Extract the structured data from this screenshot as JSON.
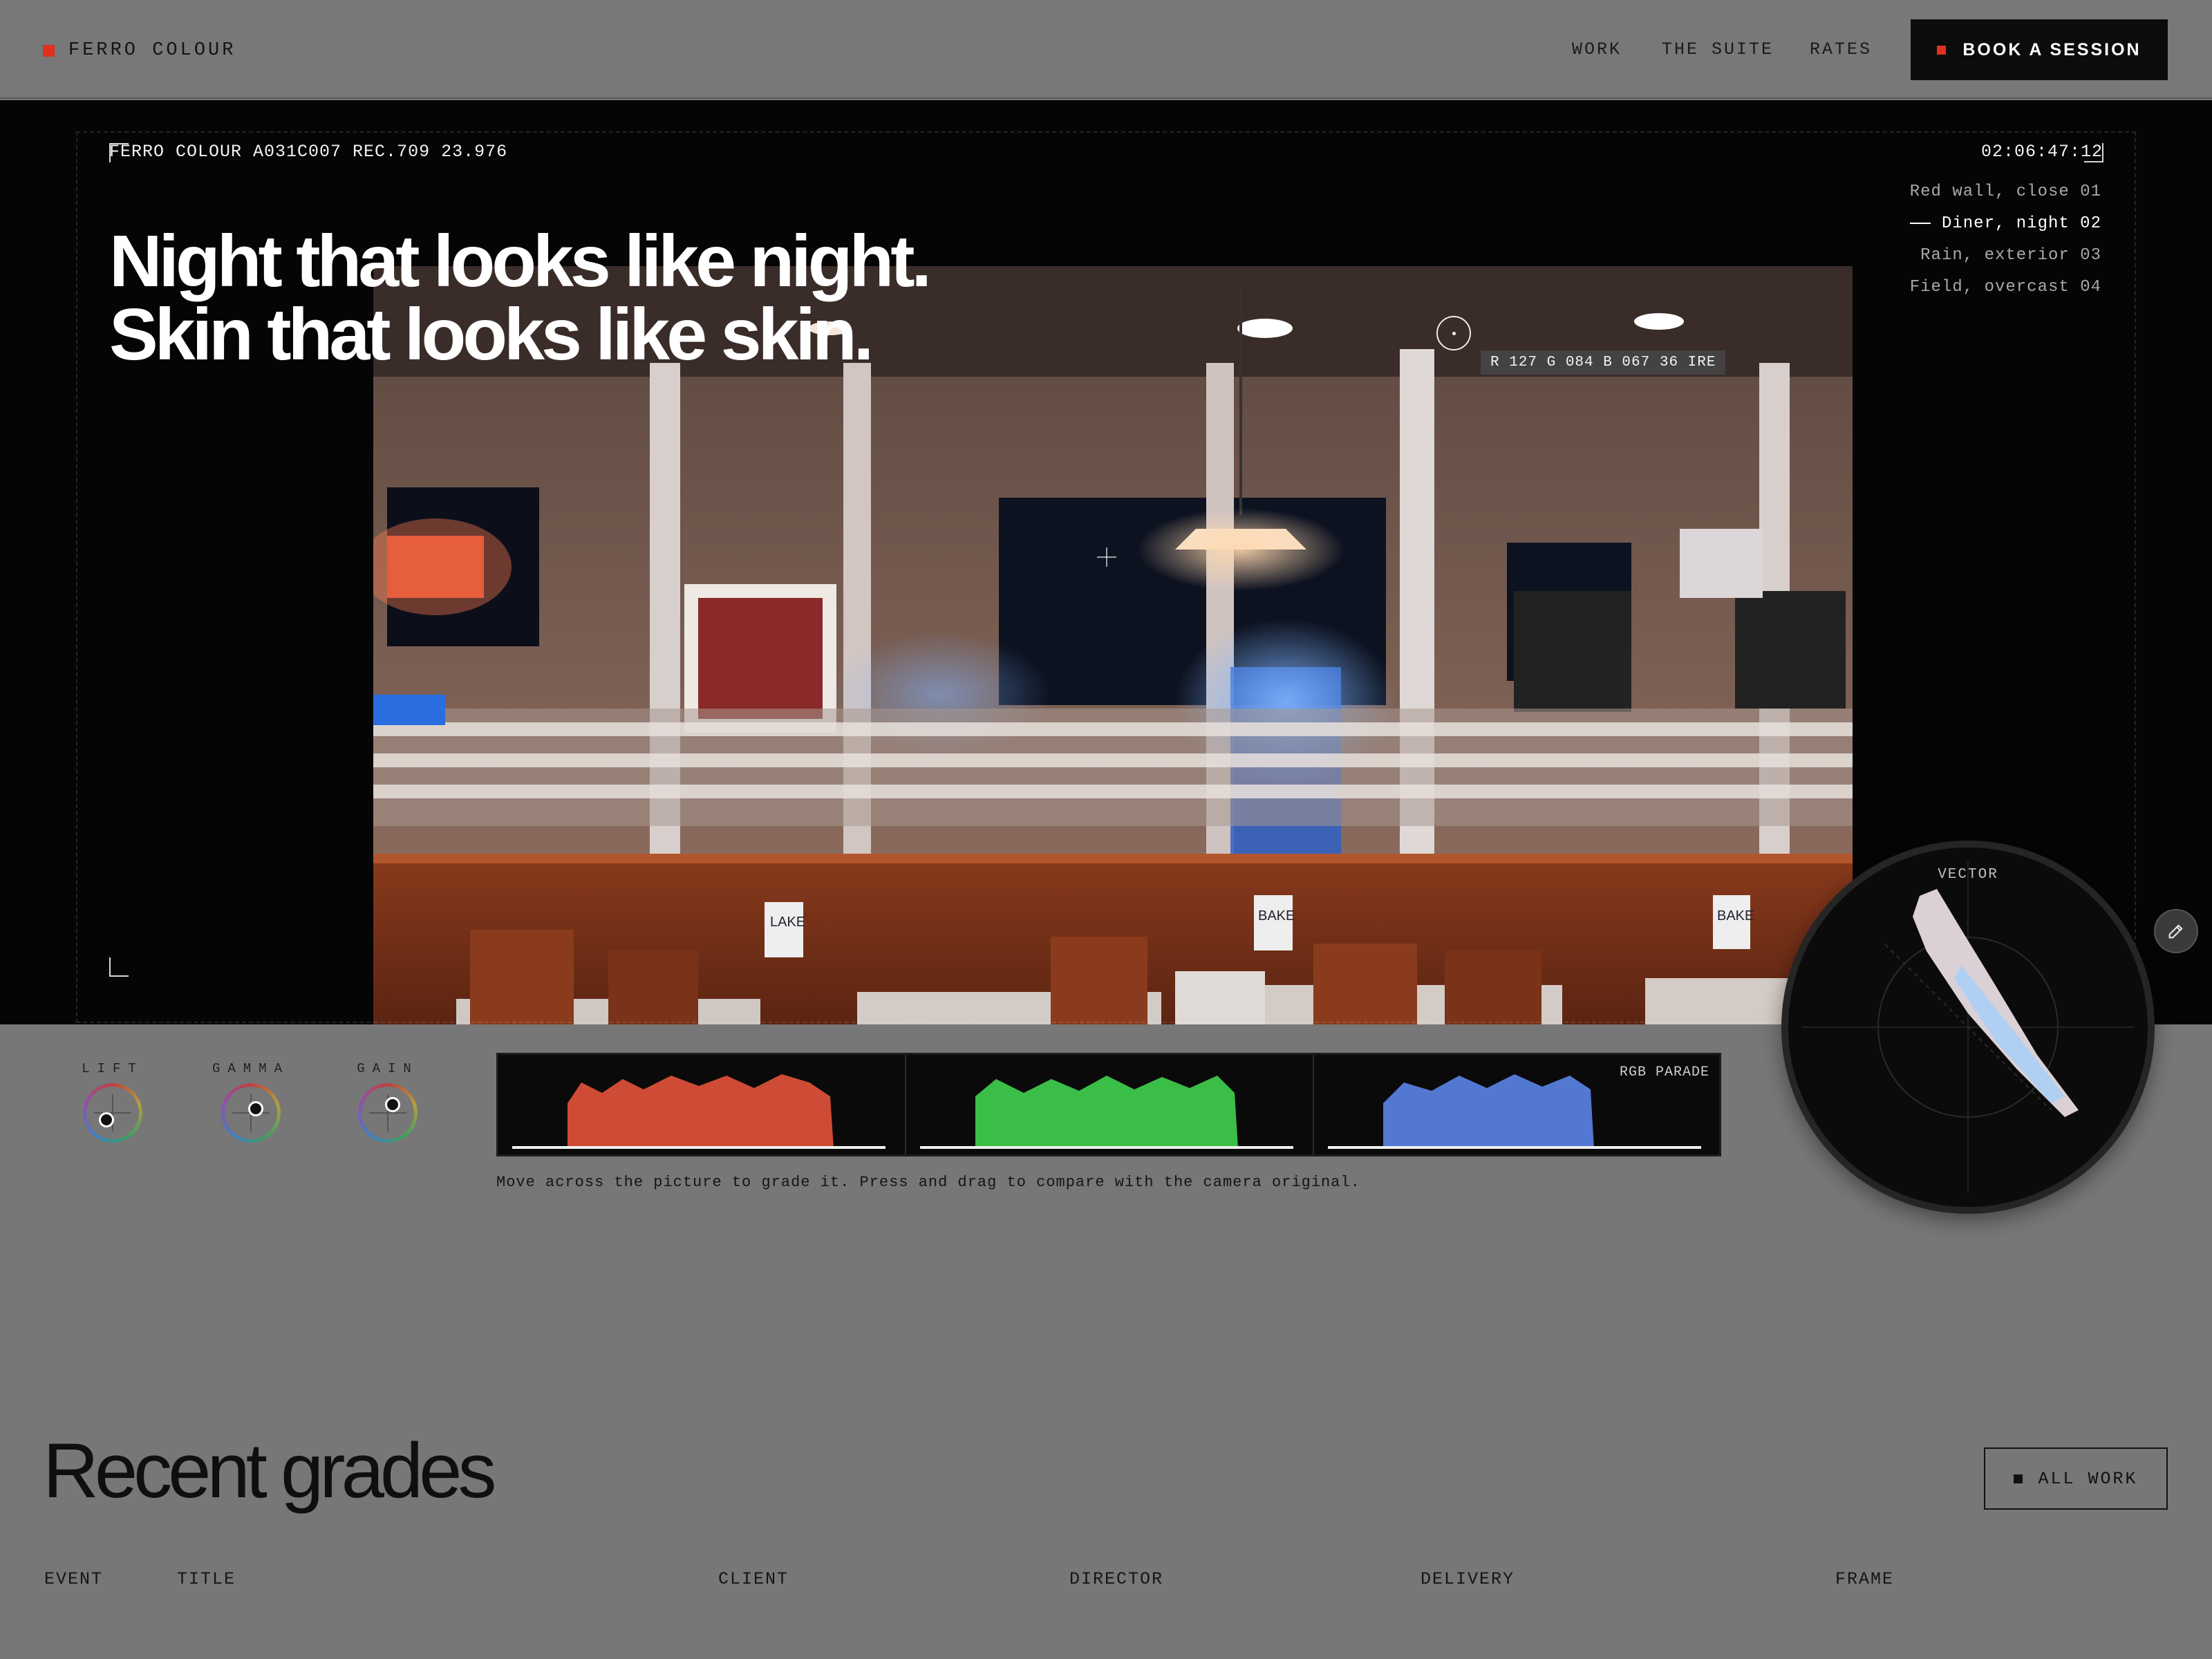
{
  "brand": {
    "name": "FERRO COLOUR",
    "accent_color": "#e0301e"
  },
  "nav": {
    "links": [
      "WORK",
      "THE SUITE",
      "RATES"
    ],
    "cta": "BOOK A SESSION"
  },
  "hero": {
    "clip_meta": "FERRO COLOUR A031C007 REC.709 23.976",
    "timecode": "02:06:47:12",
    "shots": [
      {
        "label": "Red wall, close 01",
        "active": false
      },
      {
        "label": "Diner, night 02",
        "active": true
      },
      {
        "label": "Rain, exterior 03",
        "active": false
      },
      {
        "label": "Field, overcast 04",
        "active": false
      }
    ],
    "headline_line1": "Night that looks like night.",
    "headline_line2": "Skin that looks like skin.",
    "pixel_readout": "R 127 G 084 B 067 36 IRE",
    "edit_icon": "pencil-icon",
    "photo_signs": [
      "LAKE",
      "BAKE",
      "BAKE"
    ]
  },
  "grading": {
    "wheels": [
      {
        "label": "LIFT"
      },
      {
        "label": "GAMMA"
      },
      {
        "label": "GAIN"
      }
    ],
    "parade_label": "RGB PARADE",
    "vectorscope_label": "VECTOR",
    "hint": "Move across the picture to grade it. Press and drag to compare with the camera original."
  },
  "recent": {
    "title": "Recent grades",
    "all_work": "ALL WORK",
    "columns": [
      "EVENT",
      "TITLE",
      "CLIENT",
      "DIRECTOR",
      "DELIVERY",
      "FRAME"
    ]
  }
}
